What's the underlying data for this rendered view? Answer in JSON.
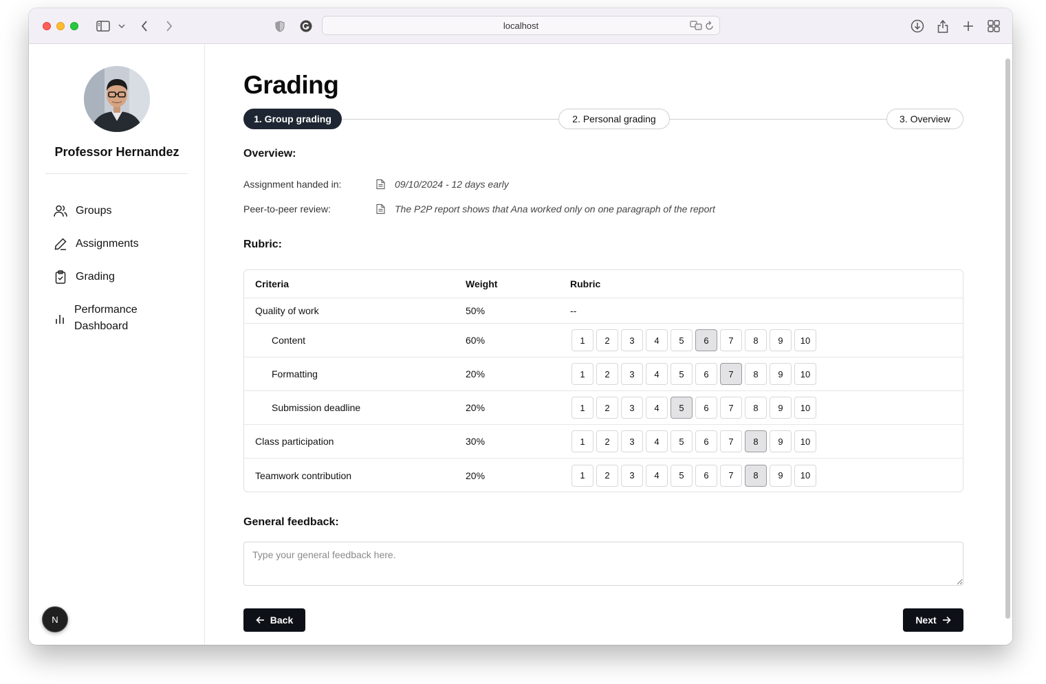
{
  "browser": {
    "address": "localhost"
  },
  "sidebar": {
    "name": "Professor Hernandez",
    "items": [
      {
        "label": "Groups",
        "icon": "users-icon"
      },
      {
        "label": "Assignments",
        "icon": "pen-icon"
      },
      {
        "label": "Grading",
        "icon": "clipboard-check-icon"
      },
      {
        "label": "Performance Dashboard",
        "icon": "bar-chart-icon"
      }
    ],
    "badge": "N"
  },
  "main": {
    "title": "Grading",
    "steps": [
      {
        "label": "1. Group grading",
        "active": true
      },
      {
        "label": "2. Personal grading",
        "active": false
      },
      {
        "label": "3. Overview",
        "active": false
      }
    ],
    "overview": {
      "heading": "Overview:",
      "rows": [
        {
          "label": "Assignment handed in:",
          "value": "09/10/2024 - 12 days early"
        },
        {
          "label": "Peer-to-peer review:",
          "value": "The P2P report shows that Ana worked only on one paragraph of the report"
        }
      ]
    },
    "rubric": {
      "heading": "Rubric:",
      "columns": [
        "Criteria",
        "Weight",
        "Rubric"
      ],
      "rows": [
        {
          "criteria": "Quality of work",
          "weight": "50%",
          "rubric": "--",
          "selected": null
        },
        {
          "criteria": "Content",
          "weight": "60%",
          "selected": 6
        },
        {
          "criteria": "Formatting",
          "weight": "20%",
          "selected": 7
        },
        {
          "criteria": "Submission deadline",
          "weight": "20%",
          "selected": 5
        },
        {
          "criteria": "Class participation",
          "weight": "30%",
          "selected": 8
        },
        {
          "criteria": "Teamwork contribution",
          "weight": "20%",
          "selected": 8
        }
      ],
      "scale": [
        "1",
        "2",
        "3",
        "4",
        "5",
        "6",
        "7",
        "8",
        "9",
        "10"
      ]
    },
    "feedback": {
      "heading": "General feedback:",
      "placeholder": "Type your general feedback here."
    },
    "buttons": {
      "back": "Back",
      "next": "Next"
    }
  },
  "colors": {
    "active_step": "#1f2633",
    "button": "#0d1117",
    "selected_score": "#e3e3e6"
  }
}
